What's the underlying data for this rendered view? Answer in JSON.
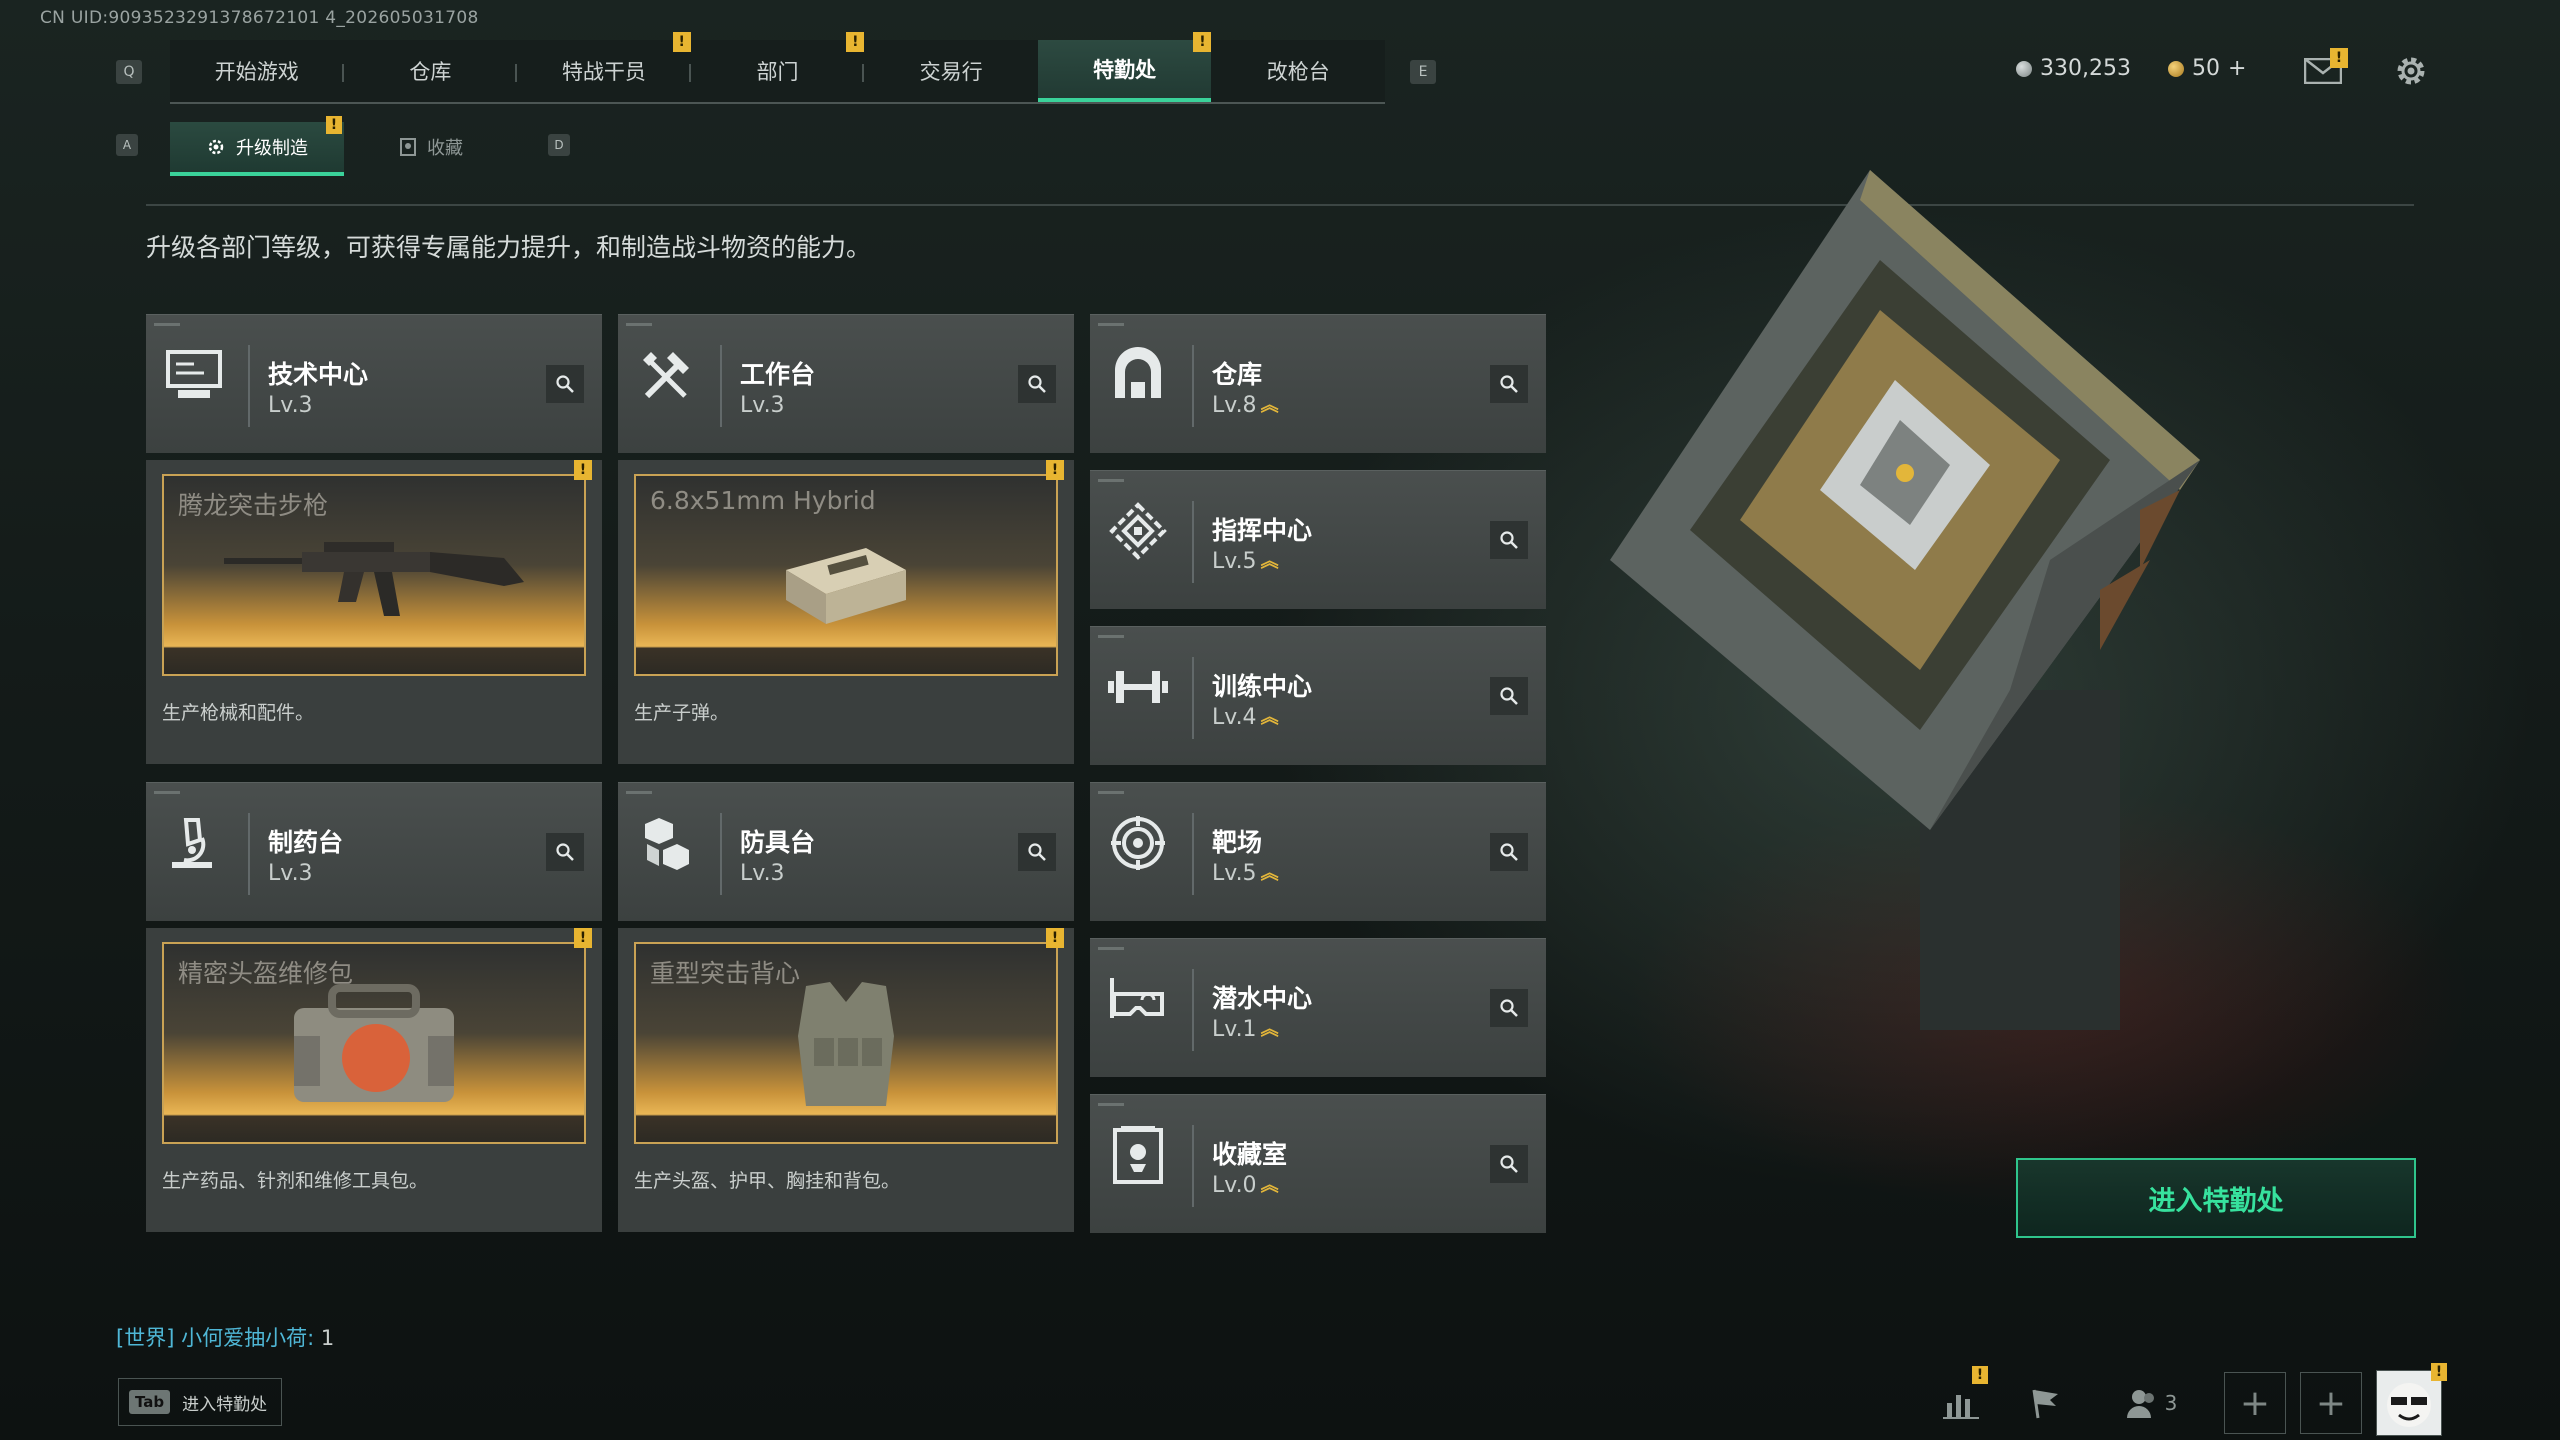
{
  "uid_text": "CN UID:9093523291378672101 4_202605031708",
  "nav": {
    "left_key": "Q",
    "right_key": "E",
    "tabs": [
      {
        "label": "开始游戏",
        "alert": false
      },
      {
        "label": "仓库",
        "alert": false
      },
      {
        "label": "特战干员",
        "alert": true
      },
      {
        "label": "部门",
        "alert": true
      },
      {
        "label": "交易行",
        "alert": false
      },
      {
        "label": "特勤处",
        "alert": true,
        "active": true
      },
      {
        "label": "改枪台",
        "alert": false
      }
    ]
  },
  "currency": {
    "silver": "330,253",
    "gold": "50",
    "plus": "+"
  },
  "alert_glyph": "!",
  "subnav": {
    "left_key": "A",
    "right_key": "D",
    "tabs": [
      {
        "label": "升级制造",
        "active": true,
        "alert": true
      },
      {
        "label": "收藏",
        "active": false,
        "alert": false
      }
    ]
  },
  "description": "升级各部门等级，可获得专属能力提升，和制造战斗物资的能力。",
  "departments": [
    {
      "name": "技术中心",
      "level": "Lv.3",
      "icon": "computer-icon",
      "upgradable": false
    },
    {
      "name": "工作台",
      "level": "Lv.3",
      "icon": "tools-icon",
      "upgradable": false
    },
    {
      "name": "仓库",
      "level": "Lv.8",
      "icon": "warehouse-icon",
      "upgradable": true
    },
    {
      "name": "指挥中心",
      "level": "Lv.5",
      "icon": "command-icon",
      "upgradable": true
    },
    {
      "name": "训练中心",
      "level": "Lv.4",
      "icon": "dumbbell-icon",
      "upgradable": true
    },
    {
      "name": "制药台",
      "level": "Lv.3",
      "icon": "microscope-icon",
      "upgradable": false
    },
    {
      "name": "防具台",
      "level": "Lv.3",
      "icon": "boxes-icon",
      "upgradable": false
    },
    {
      "name": "靶场",
      "level": "Lv.5",
      "icon": "target-icon",
      "upgradable": true
    },
    {
      "name": "潜水中心",
      "level": "Lv.1",
      "icon": "goggles-icon",
      "upgradable": true
    },
    {
      "name": "收藏室",
      "level": "Lv.0",
      "icon": "trophy-icon",
      "upgradable": true
    }
  ],
  "productions": [
    {
      "item": "腾龙突击步枪",
      "caption": "生产枪械和配件。",
      "picture": "rifle"
    },
    {
      "item": "6.8x51mm Hybrid",
      "caption": "生产子弹。",
      "picture": "ammo-box"
    },
    {
      "item": "精密头盔维修包",
      "caption": "生产药品、针剂和维修工具包。",
      "picture": "repair-bag"
    },
    {
      "item": "重型突击背心",
      "caption": "生产头盔、护甲、胸挂和背包。",
      "picture": "vest"
    }
  ],
  "enter_button": "进入特勤处",
  "chat": {
    "channel": "[世界]",
    "user": "小何爱抽小荷:",
    "message": "1"
  },
  "tab_hint": {
    "key": "Tab",
    "label": "进入特勤处"
  },
  "friends_count": "3",
  "colors": {
    "accent": "#3ad29a",
    "warning": "#e8b531",
    "gold": "#e3b63a"
  }
}
